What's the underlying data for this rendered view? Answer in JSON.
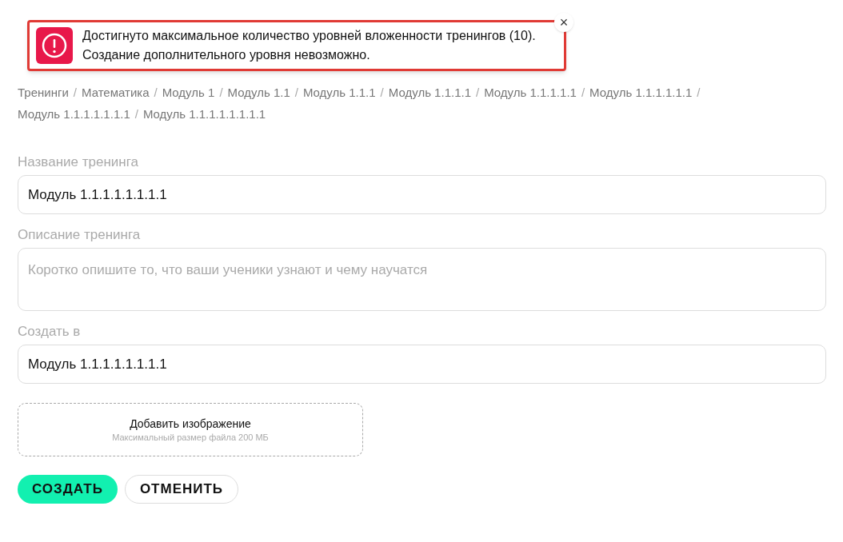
{
  "toast": {
    "kind": "error",
    "message": "Достигнуто максимальное количество уровней вложенности тренингов (10). Создание дополнительного уровня невозможно.",
    "close": "×"
  },
  "breadcrumbs": {
    "separator": "/",
    "items": [
      "Тренинги",
      "Математика",
      "Модуль 1",
      "Модуль 1.1",
      "Модуль 1.1.1",
      "Модуль 1.1.1.1",
      "Модуль 1.1.1.1.1",
      "Модуль 1.1.1.1.1.1",
      "Модуль 1.1.1.1.1.1.1",
      "Модуль 1.1.1.1.1.1.1.1"
    ]
  },
  "fields": [
    {
      "kind": "input",
      "label": "Название тренинга",
      "value": "Модуль 1.1.1.1.1.1.1.1"
    },
    {
      "kind": "textarea",
      "label": "Описание тренинга",
      "placeholder": "Коротко опишите то, что ваши ученики узнают и чему научатся"
    },
    {
      "kind": "input",
      "label": "Создать в",
      "value": "Модуль 1.1.1.1.1.1.1.1"
    }
  ],
  "upload": {
    "title": "Добавить изображение",
    "hint": "Максимальный размер файла 200 МБ"
  },
  "buttons": [
    {
      "kind": "primary",
      "label": "СОЗДАТЬ"
    },
    {
      "kind": "secondary",
      "label": "ОТМЕНИТЬ"
    }
  ]
}
